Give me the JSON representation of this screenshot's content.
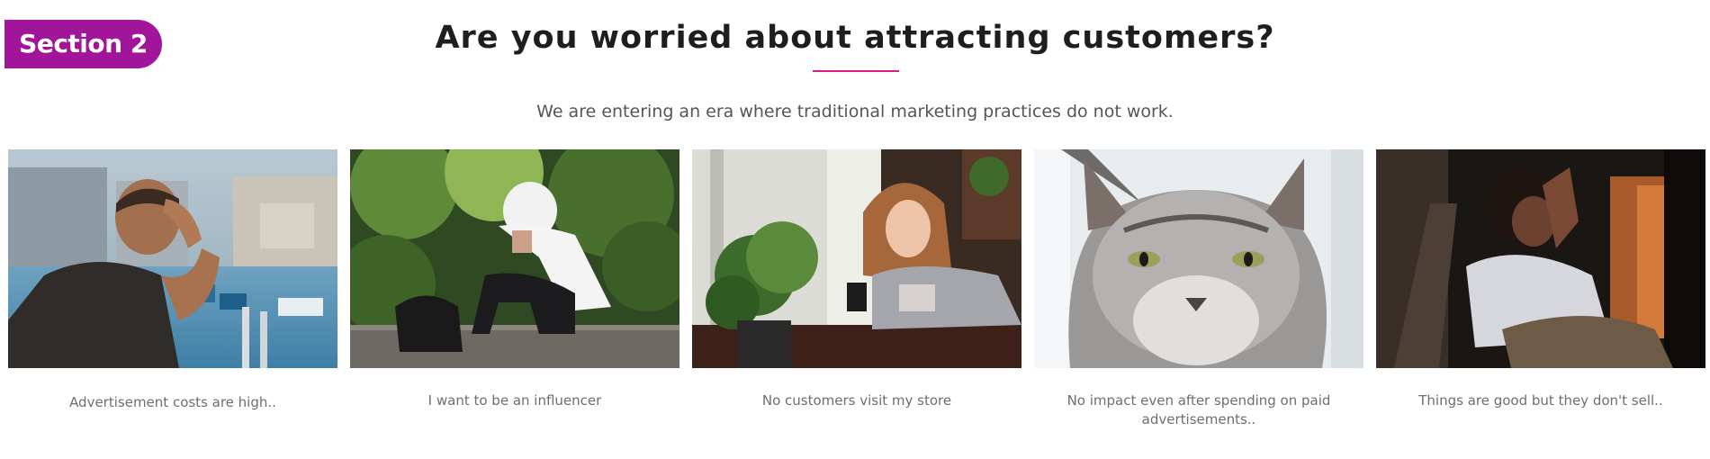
{
  "badge": {
    "label": "Section 2"
  },
  "header": {
    "title": "Are you worried about attracting customers?",
    "subtitle": "We are entering an era where traditional marketing practices do not work."
  },
  "cards": [
    {
      "caption": "Advertisement costs are high..",
      "image": "frustrated-man-at-waterfront-photo"
    },
    {
      "caption": "I want to be an influencer",
      "image": "hooded-man-sitting-on-steps-photo"
    },
    {
      "caption": "No customers visit my store",
      "image": "bored-girl-with-phone-at-table-photo"
    },
    {
      "caption": "No impact even after spending on paid advertisements..",
      "image": "grumpy-grey-cat-photo"
    },
    {
      "caption": "Things are good but they don't sell..",
      "image": "stressed-woman-on-couch-photo"
    }
  ],
  "colors": {
    "badge": "#a0159a",
    "accent_underline": "#e0187f",
    "title": "#1e1e1e",
    "text": "#6e6e6e"
  }
}
